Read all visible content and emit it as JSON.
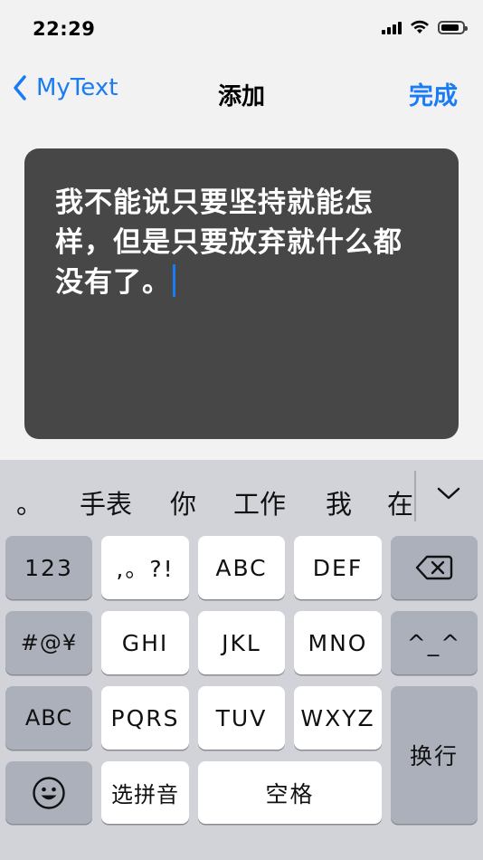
{
  "status_bar": {
    "time": "22:29"
  },
  "nav": {
    "back_label": "MyText",
    "title": "添加",
    "done_label": "完成"
  },
  "editor": {
    "text": "我不能说只要坚持就能怎样，但是只要放弃就什么都没有了。"
  },
  "keyboard": {
    "candidates": [
      "。",
      "手表",
      "你",
      "工作",
      "我",
      "在"
    ],
    "keys": {
      "num": "123",
      "punct": ",。?!",
      "abc": "ABC",
      "def": "DEF",
      "symbols": "#@¥",
      "ghi": "GHI",
      "jkl": "JKL",
      "mno": "MNO",
      "emoticon": "^_^",
      "abc_mode": "ABC",
      "pqrs": "PQRS",
      "tuv": "TUV",
      "wxyz": "WXYZ",
      "return": "换行",
      "pinyin": "选拼音",
      "space": "空格"
    }
  },
  "colors": {
    "accent": "#1a7cf5",
    "editor_bg": "#474747",
    "keyboard_bg": "#d1d3d9"
  }
}
